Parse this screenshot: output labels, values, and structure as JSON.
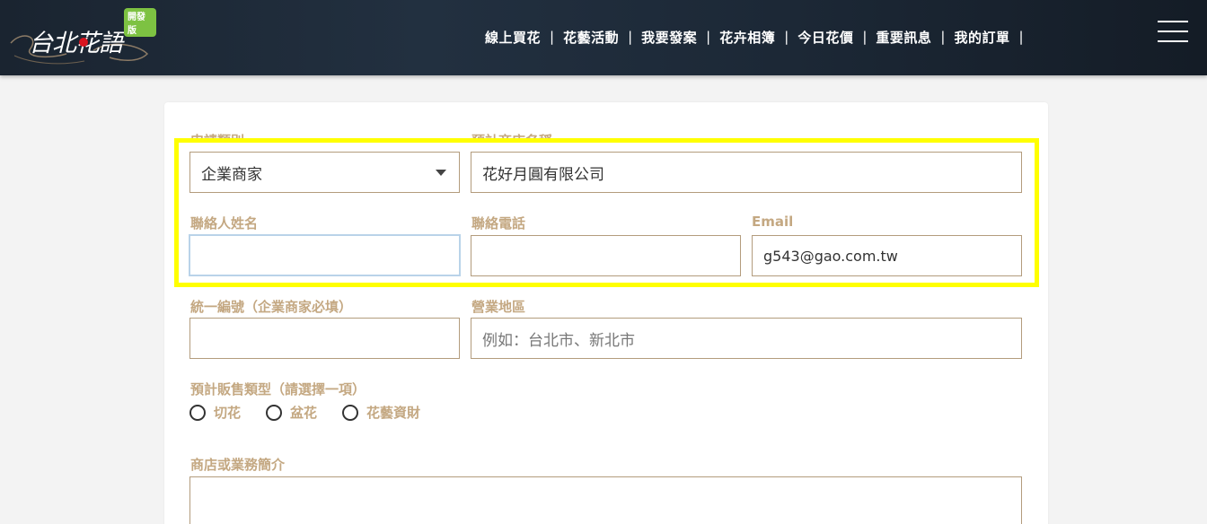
{
  "header": {
    "logo_text": "台北花語",
    "logo_badge": "開發版",
    "nav": [
      {
        "label": "線上買花"
      },
      {
        "label": "花藝活動"
      },
      {
        "label": "我要發案"
      },
      {
        "label": "花卉相簿"
      },
      {
        "label": "今日花價"
      },
      {
        "label": "重要訊息"
      },
      {
        "label": "我的訂單"
      }
    ],
    "nav_separator": "|",
    "menu_icon": "hamburger-icon"
  },
  "form": {
    "apply_type": {
      "label": "申請類別",
      "value": "企業商家"
    },
    "shop_name": {
      "label": "預計商店名稱",
      "value": "花好月圓有限公司"
    },
    "contact_name": {
      "label": "聯絡人姓名",
      "value": ""
    },
    "contact_phone": {
      "label": "聯絡電話",
      "value": ""
    },
    "email": {
      "label": "Email",
      "value": "g543@gao.com.tw"
    },
    "tax_id": {
      "label": "統一編號（企業商家必填）",
      "value": ""
    },
    "region": {
      "label": "營業地區",
      "placeholder": "例如：台北市、新北市"
    },
    "sales_type": {
      "label": "預計販售類型（請選擇一項）",
      "options": [
        "切花",
        "盆花",
        "花藝資財"
      ]
    },
    "intro": {
      "label": "商店或業務簡介",
      "value": ""
    }
  },
  "colors": {
    "label": "#c4a882",
    "border": "#b39c7d",
    "highlight": "#ffff00",
    "badge": "#7dc242"
  }
}
